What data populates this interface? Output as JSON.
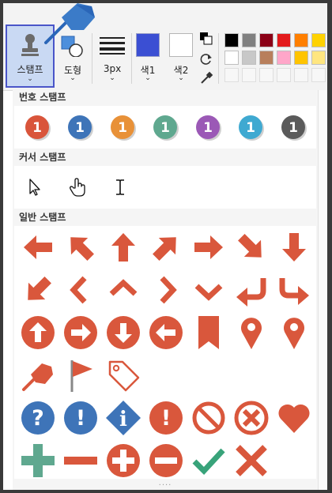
{
  "toolbar": {
    "stamp_label": "스탬프",
    "shape_label": "도형",
    "size_label": "3px",
    "color1_label": "색1",
    "color2_label": "색2",
    "color1_value": "#3b4fd3",
    "color2_value": "#ffffff",
    "palette_row1": [
      "#000000",
      "#808080",
      "#8b0016",
      "#e31a1c",
      "#ff7f00",
      "#ffd200"
    ],
    "palette_row2": [
      "#ffffff",
      "#c8c8c8",
      "#b87f5c",
      "#ffa6c9",
      "#ffc400",
      "#ffe680"
    ]
  },
  "panel": {
    "section_number": "번호 스탬프",
    "section_cursor": "커서 스탬프",
    "section_general": "일반 스탬프",
    "number_stamps": [
      {
        "text": "1",
        "color": "#d9553b"
      },
      {
        "text": "1",
        "color": "#3e74b8"
      },
      {
        "text": "1",
        "color": "#e89138"
      },
      {
        "text": "1",
        "color": "#5fa88f"
      },
      {
        "text": "1",
        "color": "#9b59b6"
      },
      {
        "text": "1",
        "color": "#3fa9d1"
      },
      {
        "text": "1",
        "color": "#5a5a5a"
      }
    ],
    "more_indicator": "....",
    "colors": {
      "accent": "#d9573c",
      "blue": "#3e74b8",
      "green": "#5fa88f",
      "teal": "#38a37a"
    }
  }
}
